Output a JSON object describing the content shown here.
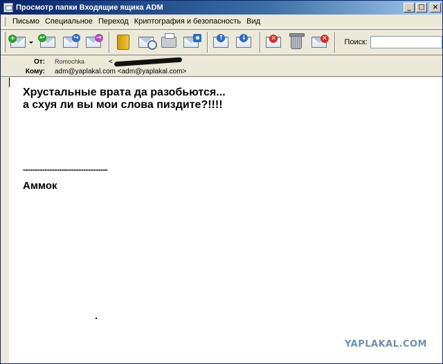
{
  "window": {
    "title": "Просмотр папки Входящие ящика ADM",
    "minimize": "_",
    "maximize": "□",
    "close": "×"
  },
  "menu": [
    {
      "label": "Письмо"
    },
    {
      "label": "Специальное"
    },
    {
      "label": "Переход"
    },
    {
      "label": "Криптография и безопасность"
    },
    {
      "label": "Вид"
    }
  ],
  "toolbar": {
    "search_label": "Поиск:",
    "search_value": "",
    "icons": [
      "new-mail-icon",
      "reply-icon",
      "reply-all-icon",
      "forward-icon",
      "address-book-icon",
      "find-icon",
      "print-icon",
      "save-icon",
      "move-icon",
      "copy-icon",
      "mark-icon",
      "delete-icon",
      "delete-forever-icon"
    ]
  },
  "header": {
    "from_label": "От:",
    "from_name": "Romochka",
    "from_email_open": "<",
    "to_label": "Кому:",
    "to_value": "adm@yaplakal.com <adm@yaplakal.com>"
  },
  "message": {
    "line1": "Хрустальные врата да разобьются...",
    "line2": "а схуя ли вы мои слова пиздите?!!!!",
    "separator": "-----------------------------------",
    "signature": "Аммок"
  },
  "watermark": "YAPLAKAL.COM"
}
